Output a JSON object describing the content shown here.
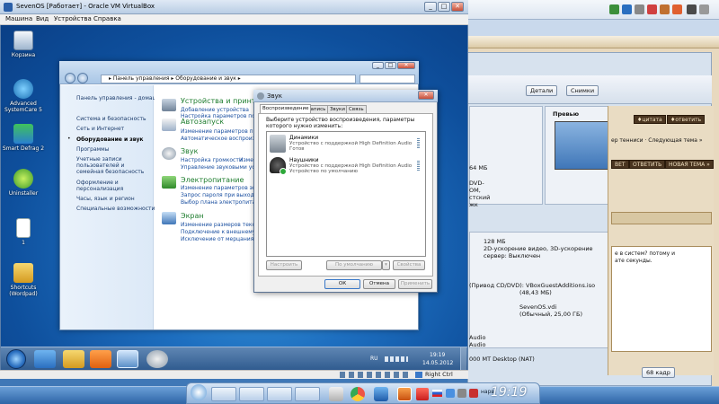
{
  "vm": {
    "title": "SevenOS [Работает] - Oracle VM VirtualBox",
    "menu": [
      "Машина",
      "Вид",
      "Устройства",
      "Справка"
    ],
    "status_host_key": "Right Ctrl"
  },
  "desktop": {
    "icons": [
      "Корзина",
      "Advanced SystemCare 5",
      "Smart Defrag 2",
      "Uninstaller",
      "1",
      "Shortcuts (Wordpad)"
    ]
  },
  "control_panel": {
    "breadcrumb": "▸ Панель управления ▸ Оборудование и звук ▸",
    "sidebar": [
      "Панель управления - домашняя страница",
      "Система и безопасность",
      "Сеть и Интернет",
      "Оборудование и звук",
      "Программы",
      "Учетные записи пользователей и семейная безопасность",
      "Оформление и персонализация",
      "Часы, язык и регион",
      "Специальные возможности"
    ],
    "categories": [
      {
        "title": "Устройства и принтеры",
        "links": [
          "Добавление устройства",
          "Настройка параметров по умолчанию"
        ]
      },
      {
        "title": "Автозапуск",
        "links": [
          "Изменение параметров по умолчанию",
          "Автоматическое воспроизведение"
        ]
      },
      {
        "title": "Звук",
        "links": [
          "Настройка громкости",
          "Изменение системных звуков",
          "Управление звуковыми устройствами"
        ]
      },
      {
        "title": "Электропитание",
        "links": [
          "Изменение параметров энергосбережения",
          "Запрос пароля при выходе из спящего режима",
          "Выбор плана электропитания"
        ]
      },
      {
        "title": "Экран",
        "links": [
          "Изменение размеров текста и других элементов",
          "Подключение к внешнему дисплею",
          "Исключение от мерцания монитора"
        ]
      }
    ]
  },
  "sound_dialog": {
    "title": "Звук",
    "tabs": [
      "Воспроизведение",
      "Запись",
      "Звуки",
      "Связь"
    ],
    "instruction": "Выберите устройство воспроизведения, параметры которого нужно изменить:",
    "devices": [
      {
        "name": "Динамики",
        "desc1": "Устройство с поддержкой High Definition Audio",
        "desc2": "Готов"
      },
      {
        "name": "Наушники",
        "desc1": "Устройство с поддержкой High Definition Audio",
        "desc2": "Устройство по умолчанию"
      }
    ],
    "buttons": {
      "configure": "Настроить",
      "default": "По умолчанию",
      "properties": "Свойства",
      "ok": "ОК",
      "cancel": "Отмена",
      "apply": "Применить"
    }
  },
  "guest_tray": {
    "lang": "RU",
    "time": "19:19",
    "date": "14.05.2012"
  },
  "host": {
    "panel_buttons": {
      "details": "Детали",
      "snapshots": "Снимки"
    },
    "preview_label": "Превью",
    "vm_info": [
      "128 МБ",
      "2D-ускорение видео, 3D-ускорение",
      "сервер: Выключен",
      "(Привод CD/DVD): VBoxGuestAdditions.iso",
      "(48,43 МБ)",
      "SevenOS.vdi",
      "(Обычный, 25,00 ГБ)",
      "Audio",
      "Audio",
      "64 МБ",
      "DVD-",
      "ОМ,",
      "стский",
      "жк"
    ],
    "forum": {
      "buttons": [
        "♦цитата",
        "♦ответить",
        "ВЕТ",
        "ОТВЕТИТЬ",
        "ЦИТАТА",
        "НОВАЯ ТЕМА »"
      ],
      "text1": "ер тенниси · Следующая тема »",
      "text2": "е в систем? потому и",
      "text3": "ате секунды.",
      "text4": "000 MT Desktop (NAT)",
      "reply_size": "68 кадр"
    },
    "clock": "19:19",
    "tray_label": "нарв"
  },
  "colors": {
    "accent": "#1e7d2e",
    "link": "#1a4fa0",
    "desktop": "#1e6fc0"
  }
}
